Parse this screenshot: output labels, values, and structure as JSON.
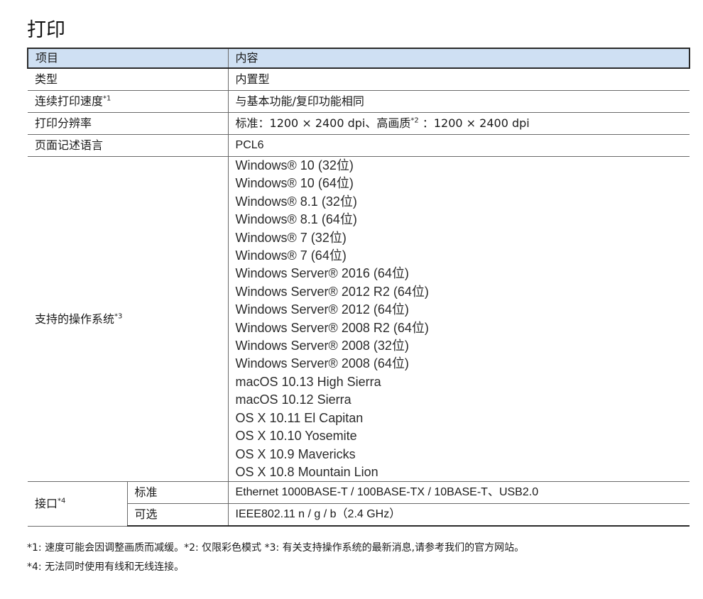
{
  "page_title": "打印",
  "table": {
    "header": {
      "col1": "项目",
      "col2": "内容"
    },
    "type": {
      "label": "类型",
      "value": "内置型"
    },
    "speed": {
      "label": "连续打印速度",
      "note": "*1",
      "value": "与基本功能/复印功能相同"
    },
    "resolution": {
      "label": "打印分辨率",
      "value_part1": "标准：1200 × 2400 dpi、高画质",
      "note": "*2",
      "value_part2": " ：1200 × 2400 dpi"
    },
    "pdl": {
      "label": "页面记述语言",
      "value": "PCL6"
    },
    "os": {
      "label": "支持的操作系统",
      "note": "*3",
      "items": [
        "Windows® 10 (32位)",
        "Windows® 10 (64位)",
        "Windows® 8.1 (32位)",
        "Windows® 8.1 (64位)",
        "Windows® 7 (32位)",
        "Windows® 7 (64位)",
        "Windows Server® 2016 (64位)",
        "Windows Server® 2012 R2 (64位)",
        "Windows Server® 2012 (64位)",
        "Windows Server® 2008 R2 (64位)",
        "Windows Server® 2008 (32位)",
        "Windows Server® 2008 (64位)",
        "macOS 10.13 High Sierra",
        "macOS 10.12 Sierra",
        "OS X 10.11 El Capitan",
        "OS X 10.10 Yosemite",
        "OS X 10.9 Mavericks",
        "OS X 10.8 Mountain Lion"
      ]
    },
    "interface": {
      "label": "接口",
      "note": "*4",
      "standard_label": "标准",
      "standard_value": "Ethernet 1000BASE-T / 100BASE-TX / 10BASE-T、USB2.0",
      "optional_label": "可选",
      "optional_value": "IEEE802.11 n / g / b（2.4 GHz）"
    }
  },
  "footnotes": {
    "line1": "*1: 速度可能会因调整画质而减缓。*2: 仅限彩色模式   *3: 有关支持操作系统的最新消息,请参考我们的官方网站。",
    "line2": "*4: 无法同时使用有线和无线连接。"
  }
}
